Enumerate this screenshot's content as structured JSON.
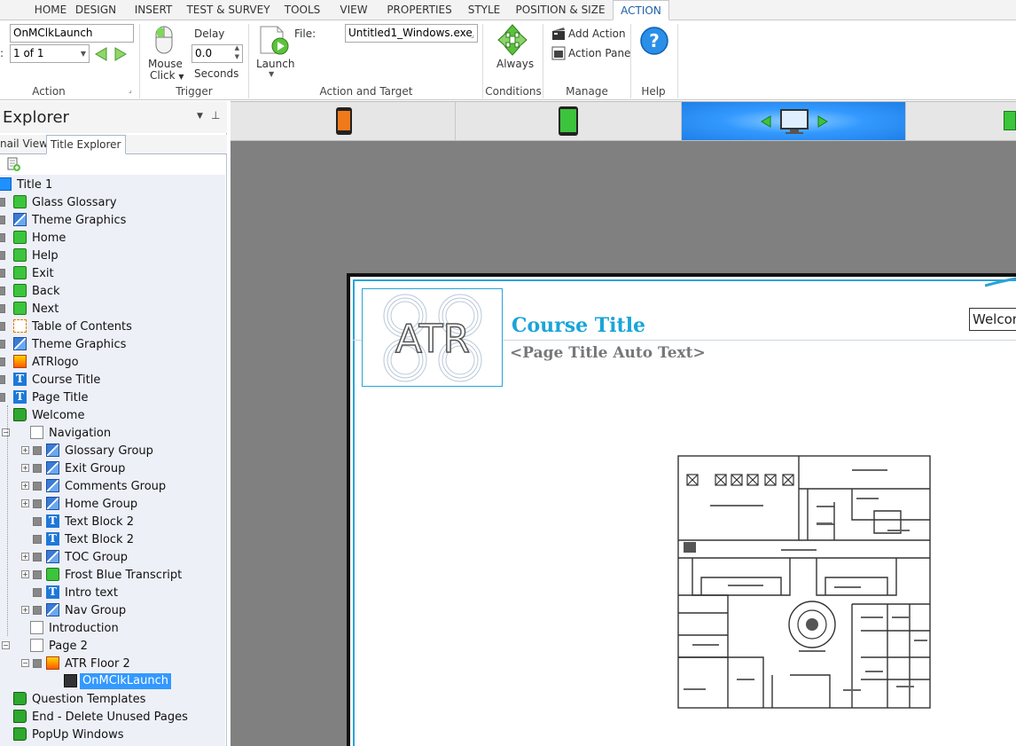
{
  "ribbon_tabs": [
    "HOME",
    "DESIGN",
    "INSERT",
    "TEST & SURVEY",
    "TOOLS",
    "VIEW",
    "PROPERTIES",
    "STYLE",
    "POSITION & SIZE",
    "ACTION"
  ],
  "active_tab": "ACTION",
  "action_group": {
    "name_value": "OnMClkLaunch",
    "count_value": "1 of 1",
    "label": "Action"
  },
  "trigger_group": {
    "trigger_label": "Mouse",
    "trigger_label2": "Click",
    "delay_label": "Delay",
    "delay_value": "0.0",
    "seconds_label": "Seconds",
    "label": "Trigger"
  },
  "action_target_group": {
    "launch_label": "Launch",
    "file_label": "File:",
    "file_value": "Untitled1_Windows.exe",
    "label": "Action and Target"
  },
  "conditions_group": {
    "always_label": "Always",
    "label": "Conditions"
  },
  "manage_group": {
    "add_action": "Add Action",
    "action_pane": "Action Pane",
    "label": "Manage"
  },
  "help_group": {
    "label": "Help"
  },
  "explorer": {
    "title": "Explorer",
    "tab_thumbnail": "nail View",
    "tab_title": "Title Explorer",
    "tree": [
      {
        "label": "Title 1",
        "icon": "title-icon",
        "indent": 0,
        "expander": "",
        "check": false
      },
      {
        "label": "Glass Glossary",
        "icon": "green-object-icon",
        "indent": 1,
        "expander": "",
        "check": true
      },
      {
        "label": "Theme Graphics",
        "icon": "group-icon",
        "indent": 1,
        "expander": "",
        "check": true
      },
      {
        "label": "Home",
        "icon": "green-object-icon",
        "indent": 1,
        "expander": "",
        "check": true
      },
      {
        "label": "Help",
        "icon": "green-object-icon",
        "indent": 1,
        "expander": "",
        "check": true
      },
      {
        "label": "Exit",
        "icon": "green-object-icon",
        "indent": 1,
        "expander": "",
        "check": true
      },
      {
        "label": "Back",
        "icon": "green-object-icon",
        "indent": 1,
        "expander": "",
        "check": true
      },
      {
        "label": "Next",
        "icon": "green-object-icon",
        "indent": 1,
        "expander": "",
        "check": true
      },
      {
        "label": "Table of Contents",
        "icon": "toc-icon",
        "indent": 1,
        "expander": "",
        "check": true
      },
      {
        "label": "Theme Graphics",
        "icon": "group-icon",
        "indent": 1,
        "expander": "",
        "check": true
      },
      {
        "label": "ATRlogo",
        "icon": "image-icon",
        "indent": 1,
        "expander": "",
        "check": true
      },
      {
        "label": "Course Title",
        "icon": "text-block-icon",
        "indent": 1,
        "expander": "",
        "check": true
      },
      {
        "label": "Page Title",
        "icon": "text-block-icon",
        "indent": 1,
        "expander": "",
        "check": true
      },
      {
        "label": "Welcome",
        "icon": "chapter-icon",
        "indent": 1,
        "expander": "",
        "check": false
      },
      {
        "label": "Navigation",
        "icon": "page-icon",
        "indent": 2,
        "expander": "−",
        "check": false
      },
      {
        "label": "Glossary Group",
        "icon": "group-icon",
        "indent": 3,
        "expander": "+",
        "check": true
      },
      {
        "label": "Exit Group",
        "icon": "group-icon",
        "indent": 3,
        "expander": "+",
        "check": true
      },
      {
        "label": "Comments Group",
        "icon": "group-icon",
        "indent": 3,
        "expander": "+",
        "check": true
      },
      {
        "label": "Home Group",
        "icon": "group-icon",
        "indent": 3,
        "expander": "+",
        "check": true
      },
      {
        "label": "Text Block 2",
        "icon": "text-block-icon",
        "indent": 3,
        "expander": "",
        "check": true
      },
      {
        "label": "Text Block 2",
        "icon": "text-block-icon",
        "indent": 3,
        "expander": "",
        "check": true
      },
      {
        "label": "TOC Group",
        "icon": "group-icon",
        "indent": 3,
        "expander": "+",
        "check": true
      },
      {
        "label": "Frost Blue Transcript",
        "icon": "green-object-icon",
        "indent": 3,
        "expander": "+",
        "check": true
      },
      {
        "label": "Intro text",
        "icon": "text-block-icon",
        "indent": 3,
        "expander": "",
        "check": true
      },
      {
        "label": "Nav Group",
        "icon": "group-icon",
        "indent": 3,
        "expander": "+",
        "check": true
      },
      {
        "label": "Introduction",
        "icon": "page-icon",
        "indent": 2,
        "expander": "",
        "check": false
      },
      {
        "label": "Page 2",
        "icon": "page-icon",
        "indent": 2,
        "expander": "−",
        "check": false
      },
      {
        "label": "ATR Floor 2",
        "icon": "image-icon",
        "indent": 3,
        "expander": "−",
        "check": true
      },
      {
        "label": "OnMClkLaunch",
        "icon": "action-icon",
        "indent": 4,
        "expander": "",
        "check": false,
        "selected": true
      },
      {
        "label": "Question Templates",
        "icon": "chapter-icon",
        "indent": 1,
        "expander": "",
        "check": false
      },
      {
        "label": "End - Delete Unused Pages",
        "icon": "chapter-icon",
        "indent": 1,
        "expander": "",
        "check": false
      },
      {
        "label": "PopUp Windows",
        "icon": "chapter-icon",
        "indent": 1,
        "expander": "",
        "check": false
      }
    ]
  },
  "devices": [
    "phone-orange-icon",
    "tablet-green-icon",
    "desktop-icon",
    "green-device-icon"
  ],
  "slide": {
    "logo_text": "ATR",
    "course_title": "Course Title",
    "page_title": "<Page Title Auto Text>",
    "welcome_box": "Welcome"
  }
}
